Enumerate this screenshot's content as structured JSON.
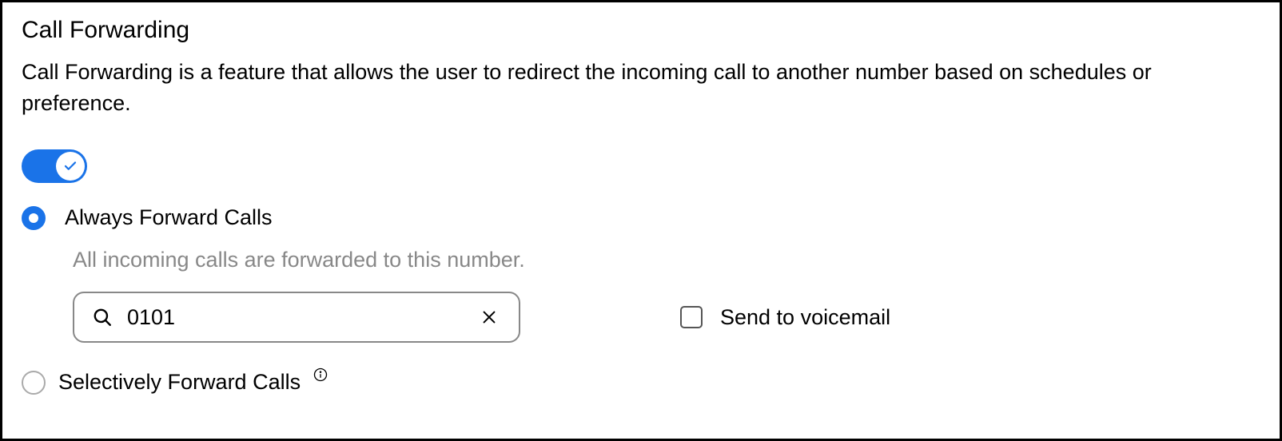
{
  "section": {
    "title": "Call Forwarding",
    "description": "Call Forwarding is a feature that allows the user to redirect the incoming call to another number based on schedules or preference."
  },
  "toggle": {
    "enabled": true
  },
  "options": {
    "always": {
      "label": "Always Forward Calls",
      "selected": true,
      "helper": "All incoming calls are forwarded to this number.",
      "number_value": "0101",
      "voicemail_label": "Send to voicemail",
      "voicemail_checked": false
    },
    "selective": {
      "label": "Selectively Forward Calls",
      "selected": false
    }
  },
  "colors": {
    "accent": "#1a73e8"
  }
}
